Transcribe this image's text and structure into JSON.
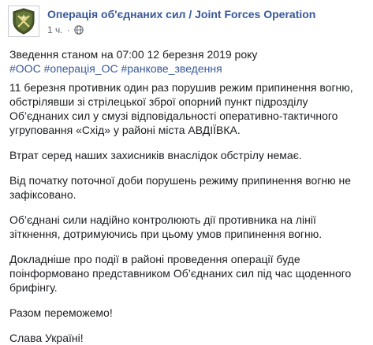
{
  "post": {
    "page_name": "Операція об'єднаних сил / Joint Forces Operation",
    "time": "1 ч.",
    "separator": "·",
    "hashtags": [
      "#ООС",
      "#операція_ОС",
      "#ранкове_зведення"
    ],
    "lines": {
      "p0": "Зведення станом на 07:00 12 березня 2019 року",
      "p1_l1": "11 березня противник один раз порушив режим припинення вогню,",
      "p1_l2": "обстрілявши зі стрілецької зброї опорний пункт підрозділу",
      "p1_l3": "Об’єднаних сил у смузі відповідальності оперативно-тактичного",
      "p1_l4": "угруповання «Схід» у районі міста АВДІЇВКА.",
      "p2_l1": "Втрат серед наших захисників внаслідок обстрілу немає.",
      "p3_l1": "Від початку поточної доби порушень режиму припинення вогню не",
      "p3_l2": "зафіксовано.",
      "p4_l1": "Об’єднані сили надійно контролюють дії противника на лінії",
      "p4_l2": "зіткнення, дотримуючись при цьому умов припинення вогню.",
      "p5_l1": "Докладніше про події в районі проведення операції буде",
      "p5_l2": "поінформовано представником Об’єднаних сил під час щоденного",
      "p5_l3": "брифінгу.",
      "p6_l1": "Разом переможемо!",
      "p7_l1": "Слава Україні!"
    },
    "colors": {
      "link": "#385898",
      "text": "#1c1e21",
      "meta": "#616770",
      "emblem": "#4b5a2a"
    },
    "icons": {
      "avatar": "joint-forces-emblem",
      "audience": "globe-icon"
    }
  }
}
